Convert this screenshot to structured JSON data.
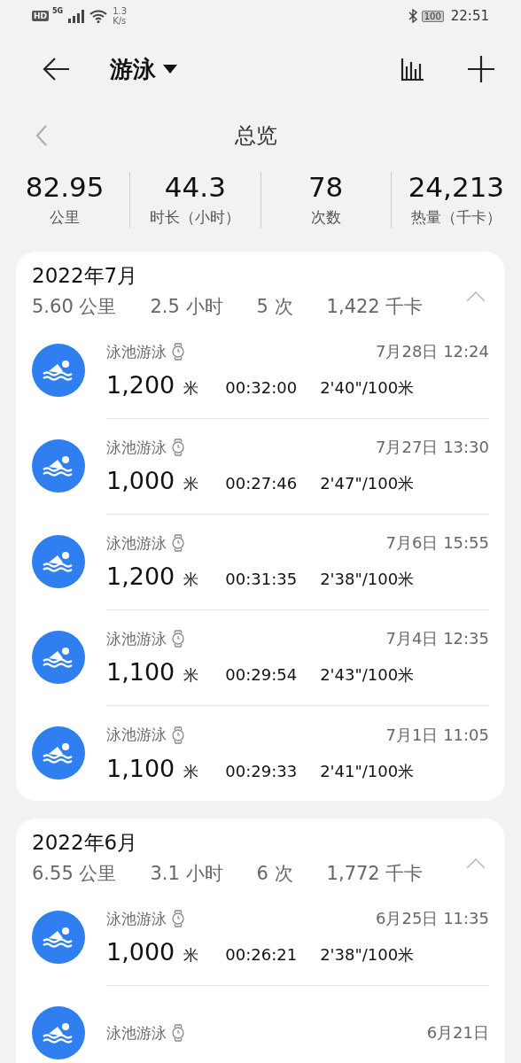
{
  "status_bar": {
    "hd_label": "HD",
    "network_type": "5G",
    "network_rate": "1.3",
    "network_unit": "K/s",
    "battery": "100",
    "time": "22:51"
  },
  "header": {
    "title": "游泳"
  },
  "overview": {
    "title": "总览",
    "stats": [
      {
        "value": "82.95",
        "label": "公里"
      },
      {
        "value": "44.3",
        "label": "时长（小时）"
      },
      {
        "value": "78",
        "label": "次数"
      },
      {
        "value": "24,213",
        "label": "热量（千卡）"
      }
    ]
  },
  "months": [
    {
      "title": "2022年7月",
      "expanded": true,
      "summary": [
        {
          "value": "5.60",
          "unit": "公里"
        },
        {
          "value": "2.5",
          "unit": "小时"
        },
        {
          "value": "5",
          "unit": "次"
        },
        {
          "value": "1,422",
          "unit": "千卡"
        }
      ],
      "records": [
        {
          "type": "泳池游泳",
          "date": "7月28日 12:24",
          "distance": "1,200",
          "unit": "米",
          "duration": "00:32:00",
          "pace": "2'40\"/100米"
        },
        {
          "type": "泳池游泳",
          "date": "7月27日 13:30",
          "distance": "1,000",
          "unit": "米",
          "duration": "00:27:46",
          "pace": "2'47\"/100米"
        },
        {
          "type": "泳池游泳",
          "date": "7月6日 15:55",
          "distance": "1,200",
          "unit": "米",
          "duration": "00:31:35",
          "pace": "2'38\"/100米"
        },
        {
          "type": "泳池游泳",
          "date": "7月4日 12:35",
          "distance": "1,100",
          "unit": "米",
          "duration": "00:29:54",
          "pace": "2'43\"/100米"
        },
        {
          "type": "泳池游泳",
          "date": "7月1日 11:05",
          "distance": "1,100",
          "unit": "米",
          "duration": "00:29:33",
          "pace": "2'41\"/100米"
        }
      ]
    },
    {
      "title": "2022年6月",
      "expanded": true,
      "summary": [
        {
          "value": "6.55",
          "unit": "公里"
        },
        {
          "value": "3.1",
          "unit": "小时"
        },
        {
          "value": "6",
          "unit": "次"
        },
        {
          "value": "1,772",
          "unit": "千卡"
        }
      ],
      "records": [
        {
          "type": "泳池游泳",
          "date": "6月25日 11:35",
          "distance": "1,000",
          "unit": "米",
          "duration": "00:26:21",
          "pace": "2'38\"/100米"
        },
        {
          "type": "泳池游泳",
          "date": "6月21日"
        }
      ]
    }
  ]
}
